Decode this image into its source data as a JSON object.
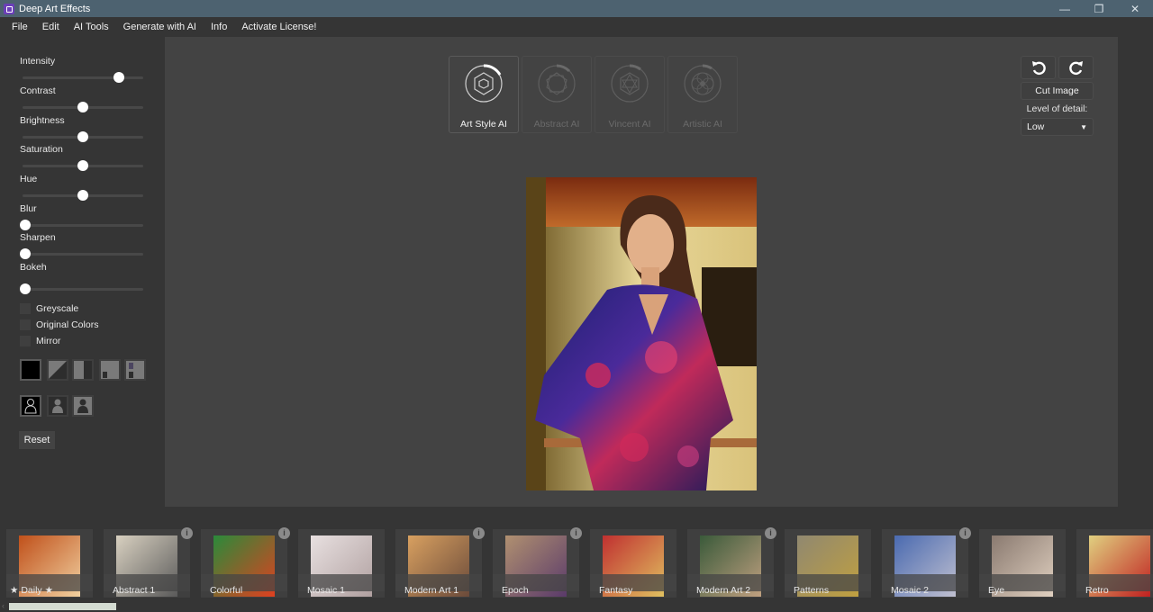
{
  "window": {
    "title": "Deep Art Effects",
    "controls": [
      "minimize",
      "restore",
      "close"
    ]
  },
  "menu": [
    "File",
    "Edit",
    "AI Tools",
    "Generate with AI",
    "Info",
    "Activate License!"
  ],
  "sidebar": {
    "sliders": [
      {
        "label": "Intensity",
        "value": 0.8
      },
      {
        "label": "Contrast",
        "value": 0.5
      },
      {
        "label": "Brightness",
        "value": 0.5
      },
      {
        "label": "Saturation",
        "value": 0.5
      },
      {
        "label": "Hue",
        "value": 0.5
      },
      {
        "label": "Blur",
        "value": 0.0
      },
      {
        "label": "Sharpen",
        "value": 0.0
      },
      {
        "label": "Bokeh",
        "value": 0.0
      }
    ],
    "checkboxes": [
      {
        "label": "Greyscale",
        "checked": false
      },
      {
        "label": "Original Colors",
        "checked": false
      },
      {
        "label": "Mirror",
        "checked": false
      }
    ],
    "mask_modes": [
      "full-mask",
      "diagonal-mask",
      "right-half-mask",
      "corner-mask",
      "split-mask"
    ],
    "person_modes": [
      "person-outline",
      "person-foreground",
      "person-background"
    ],
    "reset_label": "Reset"
  },
  "ai_tabs": [
    {
      "label": "Art Style AI",
      "active": true
    },
    {
      "label": "Abstract AI",
      "active": false
    },
    {
      "label": "Vincent AI",
      "active": false
    },
    {
      "label": "Artistic AI",
      "active": false
    }
  ],
  "controls": {
    "cut_image_label": "Cut Image",
    "level_of_detail_label": "Level of detail:",
    "level_of_detail_value": "Low"
  },
  "styles": [
    {
      "label": "★ Daily ★",
      "info": false
    },
    {
      "label": "Abstract 1",
      "info": true
    },
    {
      "label": "Colorful",
      "info": true
    },
    {
      "label": "Mosaic 1",
      "info": false
    },
    {
      "label": "Modern Art 1",
      "info": true
    },
    {
      "label": "Epoch",
      "info": true
    },
    {
      "label": "Fantasy",
      "info": false
    },
    {
      "label": "Modern Art 2",
      "info": true
    },
    {
      "label": "Patterns",
      "info": false
    },
    {
      "label": "Mosaic 2",
      "info": true
    },
    {
      "label": "Eye",
      "info": false
    },
    {
      "label": "Retro",
      "info": true
    }
  ],
  "info_glyph": "i"
}
